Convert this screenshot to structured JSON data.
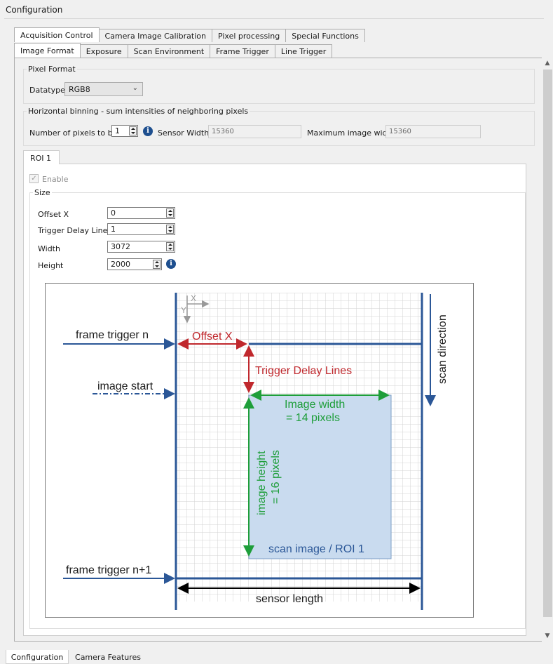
{
  "window": {
    "title": "Configuration"
  },
  "main_tabs": [
    {
      "label": "Acquisition Control",
      "active": true
    },
    {
      "label": "Camera Image Calibration",
      "active": false
    },
    {
      "label": "Pixel processing",
      "active": false
    },
    {
      "label": "Special Functions",
      "active": false
    }
  ],
  "sub_tabs": [
    {
      "label": "Image Format",
      "active": true
    },
    {
      "label": "Exposure",
      "active": false
    },
    {
      "label": "Scan Environment",
      "active": false
    },
    {
      "label": "Frame Trigger",
      "active": false
    },
    {
      "label": "Line Trigger",
      "active": false
    }
  ],
  "pixel_format": {
    "legend": "Pixel Format",
    "datatype_label": "Datatype",
    "datatype_value": "RGB8"
  },
  "binning": {
    "legend": "Horizontal binning - sum intensities of neighboring pixels",
    "bin_label": "Number of pixels to bin",
    "bin_value": "1",
    "sensor_width_label": "Sensor Width",
    "sensor_width_value": "15360",
    "max_width_label": "Maximum image width",
    "max_width_value": "15360"
  },
  "roi_tab": {
    "label": "ROI 1"
  },
  "roi": {
    "enable_label": "Enable",
    "enable_checked": true,
    "size_legend": "Size",
    "fields": [
      {
        "label": "Offset X",
        "value": "0"
      },
      {
        "label": "Trigger Delay Lines",
        "value": "1"
      },
      {
        "label": "Width",
        "value": "3072"
      },
      {
        "label": "Height",
        "value": "2000"
      }
    ]
  },
  "diagram": {
    "frame_trigger_n": "frame trigger n",
    "image_start": "image start",
    "frame_trigger_n1": "frame trigger n+1",
    "offset_x": "Offset X",
    "trigger_delay_lines": "Trigger Delay Lines",
    "image_width_1": "Image width",
    "image_width_2": "= 14 pixels",
    "image_height_1": "image height",
    "image_height_2": "= 16 pixels",
    "roi_label": "scan image / ROI 1",
    "sensor_length": "sensor length",
    "scan_direction": "scan direction",
    "axis_x": "X",
    "axis_y": "Y",
    "colors": {
      "blue": "#2b5797",
      "red": "#c0282d",
      "green": "#1e9e3a",
      "roi_fill": "#c9dbef",
      "grid": "#d3d3d3"
    }
  },
  "bottom_tabs": [
    {
      "label": "Configuration",
      "active": true
    },
    {
      "label": "Camera Features",
      "active": false
    }
  ]
}
